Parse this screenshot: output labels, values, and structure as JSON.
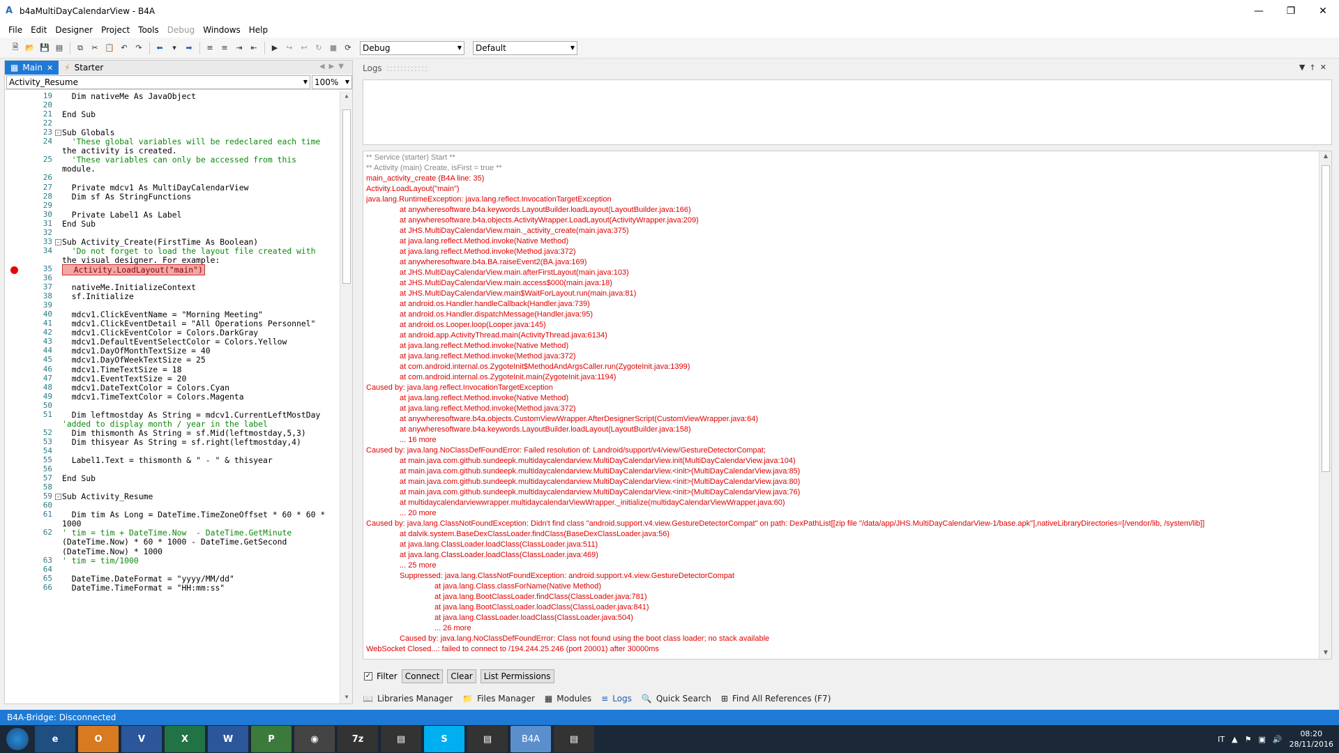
{
  "window": {
    "title": "b4aMultiDayCalendarView - B4A",
    "app_icon": "A"
  },
  "menu": [
    "File",
    "Edit",
    "Designer",
    "Project",
    "Tools",
    "Debug",
    "Windows",
    "Help"
  ],
  "toolbar": {
    "config_combo": "Debug",
    "profile_combo": "Default"
  },
  "editor": {
    "tabs": [
      {
        "label": "Main",
        "active": true
      },
      {
        "label": "Starter",
        "active": false
      }
    ],
    "sub_selector": "Activity_Resume",
    "zoom": "100%",
    "breakpoint_line": "35",
    "lines": [
      {
        "n": "19",
        "t": "  Dim nativeMe As JavaObject"
      },
      {
        "n": "20",
        "t": ""
      },
      {
        "n": "21",
        "t": "End Sub"
      },
      {
        "n": "22",
        "t": ""
      },
      {
        "n": "23",
        "t": "Sub Globals",
        "fold": true
      },
      {
        "n": "24",
        "t": "  'These global variables will be redeclared each time"
      },
      {
        "n": "",
        "t": "the activity is created."
      },
      {
        "n": "25",
        "t": "  'These variables can only be accessed from this"
      },
      {
        "n": "",
        "t": "module."
      },
      {
        "n": "26",
        "t": ""
      },
      {
        "n": "27",
        "t": "  Private mdcv1 As MultiDayCalendarView"
      },
      {
        "n": "28",
        "t": "  Dim sf As StringFunctions"
      },
      {
        "n": "29",
        "t": ""
      },
      {
        "n": "30",
        "t": "  Private Label1 As Label"
      },
      {
        "n": "31",
        "t": "End Sub"
      },
      {
        "n": "32",
        "t": ""
      },
      {
        "n": "33",
        "t": "Sub Activity_Create(FirstTime As Boolean)",
        "fold": true
      },
      {
        "n": "34",
        "t": "  'Do not forget to load the layout file created with"
      },
      {
        "n": "",
        "t": "the visual designer. For example:"
      },
      {
        "n": "35",
        "t": "  Activity.LoadLayout(\"main\")",
        "bp": true
      },
      {
        "n": "36",
        "t": ""
      },
      {
        "n": "37",
        "t": "  nativeMe.InitializeContext"
      },
      {
        "n": "38",
        "t": "  sf.Initialize"
      },
      {
        "n": "39",
        "t": ""
      },
      {
        "n": "40",
        "t": "  mdcv1.ClickEventName = \"Morning Meeting\""
      },
      {
        "n": "41",
        "t": "  mdcv1.ClickEventDetail = \"All Operations Personnel\""
      },
      {
        "n": "42",
        "t": "  mdcv1.ClickEventColor = Colors.DarkGray"
      },
      {
        "n": "43",
        "t": "  mdcv1.DefaultEventSelectColor = Colors.Yellow"
      },
      {
        "n": "44",
        "t": "  mdcv1.DayOfMonthTextSize = 40"
      },
      {
        "n": "45",
        "t": "  mdcv1.DayOfWeekTextSize = 25"
      },
      {
        "n": "46",
        "t": "  mdcv1.TimeTextSize = 18"
      },
      {
        "n": "47",
        "t": "  mdcv1.EventTextSize = 20"
      },
      {
        "n": "48",
        "t": "  mdcv1.DateTextColor = Colors.Cyan"
      },
      {
        "n": "49",
        "t": "  mdcv1.TimeTextColor = Colors.Magenta"
      },
      {
        "n": "50",
        "t": ""
      },
      {
        "n": "51",
        "t": "  Dim leftmostday As String = mdcv1.CurrentLeftMostDay"
      },
      {
        "n": "",
        "t": "'added to display month / year in the label"
      },
      {
        "n": "52",
        "t": "  Dim thismonth As String = sf.Mid(leftmostday,5,3)"
      },
      {
        "n": "53",
        "t": "  Dim thisyear As String = sf.right(leftmostday,4)"
      },
      {
        "n": "54",
        "t": ""
      },
      {
        "n": "55",
        "t": "  Label1.Text = thismonth & \" - \" & thisyear"
      },
      {
        "n": "56",
        "t": ""
      },
      {
        "n": "57",
        "t": "End Sub"
      },
      {
        "n": "58",
        "t": ""
      },
      {
        "n": "59",
        "t": "Sub Activity_Resume",
        "fold": true
      },
      {
        "n": "60",
        "t": ""
      },
      {
        "n": "61",
        "t": "  Dim tim As Long = DateTime.TimeZoneOffset * 60 * 60 *"
      },
      {
        "n": "",
        "t": "1000"
      },
      {
        "n": "62",
        "t": "' tim = tim + DateTime.Now  - DateTime.GetMinute"
      },
      {
        "n": "",
        "t": "(DateTime.Now) * 60 * 1000 - DateTime.GetSecond"
      },
      {
        "n": "",
        "t": "(DateTime.Now) * 1000"
      },
      {
        "n": "63",
        "t": "' tim = tim/1000"
      },
      {
        "n": "64",
        "t": ""
      },
      {
        "n": "65",
        "t": "  DateTime.DateFormat = \"yyyy/MM/dd\""
      },
      {
        "n": "66",
        "t": "  DateTime.TimeFormat = \"HH:mm:ss\""
      }
    ]
  },
  "logs": {
    "title": "Logs",
    "lines": [
      {
        "c": "gray",
        "i": 0,
        "t": "** Service (starter) Start **"
      },
      {
        "c": "gray",
        "i": 0,
        "t": "** Activity (main) Create, isFirst = true **"
      },
      {
        "c": "red",
        "i": 0,
        "t": "main_activity_create (B4A line: 35)"
      },
      {
        "c": "red",
        "i": 0,
        "t": "Activity.LoadLayout(\"main\")"
      },
      {
        "c": "red",
        "i": 0,
        "t": "java.lang.RuntimeException: java.lang.reflect.InvocationTargetException"
      },
      {
        "c": "red",
        "i": 1,
        "t": "at anywheresoftware.b4a.keywords.LayoutBuilder.loadLayout(LayoutBuilder.java:166)"
      },
      {
        "c": "red",
        "i": 1,
        "t": "at anywheresoftware.b4a.objects.ActivityWrapper.LoadLayout(ActivityWrapper.java:209)"
      },
      {
        "c": "red",
        "i": 1,
        "t": "at JHS.MultiDayCalendarView.main._activity_create(main.java:375)"
      },
      {
        "c": "red",
        "i": 1,
        "t": "at java.lang.reflect.Method.invoke(Native Method)"
      },
      {
        "c": "red",
        "i": 1,
        "t": "at java.lang.reflect.Method.invoke(Method.java:372)"
      },
      {
        "c": "red",
        "i": 1,
        "t": "at anywheresoftware.b4a.BA.raiseEvent2(BA.java:169)"
      },
      {
        "c": "red",
        "i": 1,
        "t": "at JHS.MultiDayCalendarView.main.afterFirstLayout(main.java:103)"
      },
      {
        "c": "red",
        "i": 1,
        "t": "at JHS.MultiDayCalendarView.main.access$000(main.java:18)"
      },
      {
        "c": "red",
        "i": 1,
        "t": "at JHS.MultiDayCalendarView.main$WaitForLayout.run(main.java:81)"
      },
      {
        "c": "red",
        "i": 1,
        "t": "at android.os.Handler.handleCallback(Handler.java:739)"
      },
      {
        "c": "red",
        "i": 1,
        "t": "at android.os.Handler.dispatchMessage(Handler.java:95)"
      },
      {
        "c": "red",
        "i": 1,
        "t": "at android.os.Looper.loop(Looper.java:145)"
      },
      {
        "c": "red",
        "i": 1,
        "t": "at android.app.ActivityThread.main(ActivityThread.java:6134)"
      },
      {
        "c": "red",
        "i": 1,
        "t": "at java.lang.reflect.Method.invoke(Native Method)"
      },
      {
        "c": "red",
        "i": 1,
        "t": "at java.lang.reflect.Method.invoke(Method.java:372)"
      },
      {
        "c": "red",
        "i": 1,
        "t": "at com.android.internal.os.ZygoteInit$MethodAndArgsCaller.run(ZygoteInit.java:1399)"
      },
      {
        "c": "red",
        "i": 1,
        "t": "at com.android.internal.os.ZygoteInit.main(ZygoteInit.java:1194)"
      },
      {
        "c": "red",
        "i": 0,
        "t": "Caused by: java.lang.reflect.InvocationTargetException"
      },
      {
        "c": "red",
        "i": 1,
        "t": "at java.lang.reflect.Method.invoke(Native Method)"
      },
      {
        "c": "red",
        "i": 1,
        "t": "at java.lang.reflect.Method.invoke(Method.java:372)"
      },
      {
        "c": "red",
        "i": 1,
        "t": "at anywheresoftware.b4a.objects.CustomViewWrapper.AfterDesignerScript(CustomViewWrapper.java:64)"
      },
      {
        "c": "red",
        "i": 1,
        "t": "at anywheresoftware.b4a.keywords.LayoutBuilder.loadLayout(LayoutBuilder.java:158)"
      },
      {
        "c": "red",
        "i": 1,
        "t": "... 16 more"
      },
      {
        "c": "red",
        "i": 0,
        "t": "Caused by: java.lang.NoClassDefFoundError: Failed resolution of: Landroid/support/v4/view/GestureDetectorCompat;"
      },
      {
        "c": "red",
        "i": 1,
        "t": "at main.java.com.github.sundeepk.multidaycalendarview.MultiDayCalendarView.init(MultiDayCalendarView.java:104)"
      },
      {
        "c": "red",
        "i": 1,
        "t": "at main.java.com.github.sundeepk.multidaycalendarview.MultiDayCalendarView.<init>(MultiDayCalendarView.java:85)"
      },
      {
        "c": "red",
        "i": 1,
        "t": "at main.java.com.github.sundeepk.multidaycalendarview.MultiDayCalendarView.<init>(MultiDayCalendarView.java:80)"
      },
      {
        "c": "red",
        "i": 1,
        "t": "at main.java.com.github.sundeepk.multidaycalendarview.MultiDayCalendarView.<init>(MultiDayCalendarView.java:76)"
      },
      {
        "c": "red",
        "i": 1,
        "t": "at multidaycalendarviewwrapper.multidaycalendarViewWrapper._initialize(multidayCalendarViewWrapper.java:60)"
      },
      {
        "c": "red",
        "i": 1,
        "t": "... 20 more"
      },
      {
        "c": "red",
        "i": 0,
        "t": "Caused by: java.lang.ClassNotFoundException: Didn't find class \"android.support.v4.view.GestureDetectorCompat\" on path: DexPathList[[zip file \"/data/app/JHS.MultiDayCalendarView-1/base.apk\"],nativeLibraryDirectories=[/vendor/lib, /system/lib]]"
      },
      {
        "c": "red",
        "i": 1,
        "t": "at dalvik.system.BaseDexClassLoader.findClass(BaseDexClassLoader.java:56)"
      },
      {
        "c": "red",
        "i": 1,
        "t": "at java.lang.ClassLoader.loadClass(ClassLoader.java:511)"
      },
      {
        "c": "red",
        "i": 1,
        "t": "at java.lang.ClassLoader.loadClass(ClassLoader.java:469)"
      },
      {
        "c": "red",
        "i": 1,
        "t": "... 25 more"
      },
      {
        "c": "red",
        "i": 1,
        "t": "Suppressed: java.lang.ClassNotFoundException: android.support.v4.view.GestureDetectorCompat"
      },
      {
        "c": "red",
        "i": 2,
        "t": "at java.lang.Class.classForName(Native Method)"
      },
      {
        "c": "red",
        "i": 2,
        "t": "at java.lang.BootClassLoader.findClass(ClassLoader.java:781)"
      },
      {
        "c": "red",
        "i": 2,
        "t": "at java.lang.BootClassLoader.loadClass(ClassLoader.java:841)"
      },
      {
        "c": "red",
        "i": 2,
        "t": "at java.lang.ClassLoader.loadClass(ClassLoader.java:504)"
      },
      {
        "c": "red",
        "i": 2,
        "t": "... 26 more"
      },
      {
        "c": "red",
        "i": 1,
        "t": "Caused by: java.lang.NoClassDefFoundError: Class not found using the boot class loader; no stack available"
      },
      {
        "c": "red",
        "i": 0,
        "t": "WebSocket Closed...: failed to connect to /194.244.25.246 (port 20001) after 30000ms"
      }
    ],
    "filter_label": "Filter",
    "filter_checked": true,
    "connect_label": "Connect",
    "clear_label": "Clear",
    "permissions_label": "List Permissions"
  },
  "bottom_tabs": [
    {
      "label": "Libraries Manager",
      "icon": "book-icon"
    },
    {
      "label": "Files Manager",
      "icon": "folder-icon"
    },
    {
      "label": "Modules",
      "icon": "modules-icon"
    },
    {
      "label": "Logs",
      "icon": "logs-icon",
      "active": true
    },
    {
      "label": "Quick Search",
      "icon": "search-icon"
    },
    {
      "label": "Find All References (F7)",
      "icon": "references-icon"
    }
  ],
  "status": "B4A-Bridge: Disconnected",
  "taskbar": {
    "apps": [
      "ie-icon",
      "outlook-icon",
      "visio-icon",
      "excel-icon",
      "word-icon",
      "project-icon",
      "chrome-icon",
      "7zip-icon",
      "scanner-icon",
      "skype-icon",
      "notepad-icon",
      "b4a-icon",
      "document-icon"
    ],
    "b4a_label": "B4A",
    "lang": "IT",
    "time": "08:20",
    "date": "28/11/2016"
  }
}
